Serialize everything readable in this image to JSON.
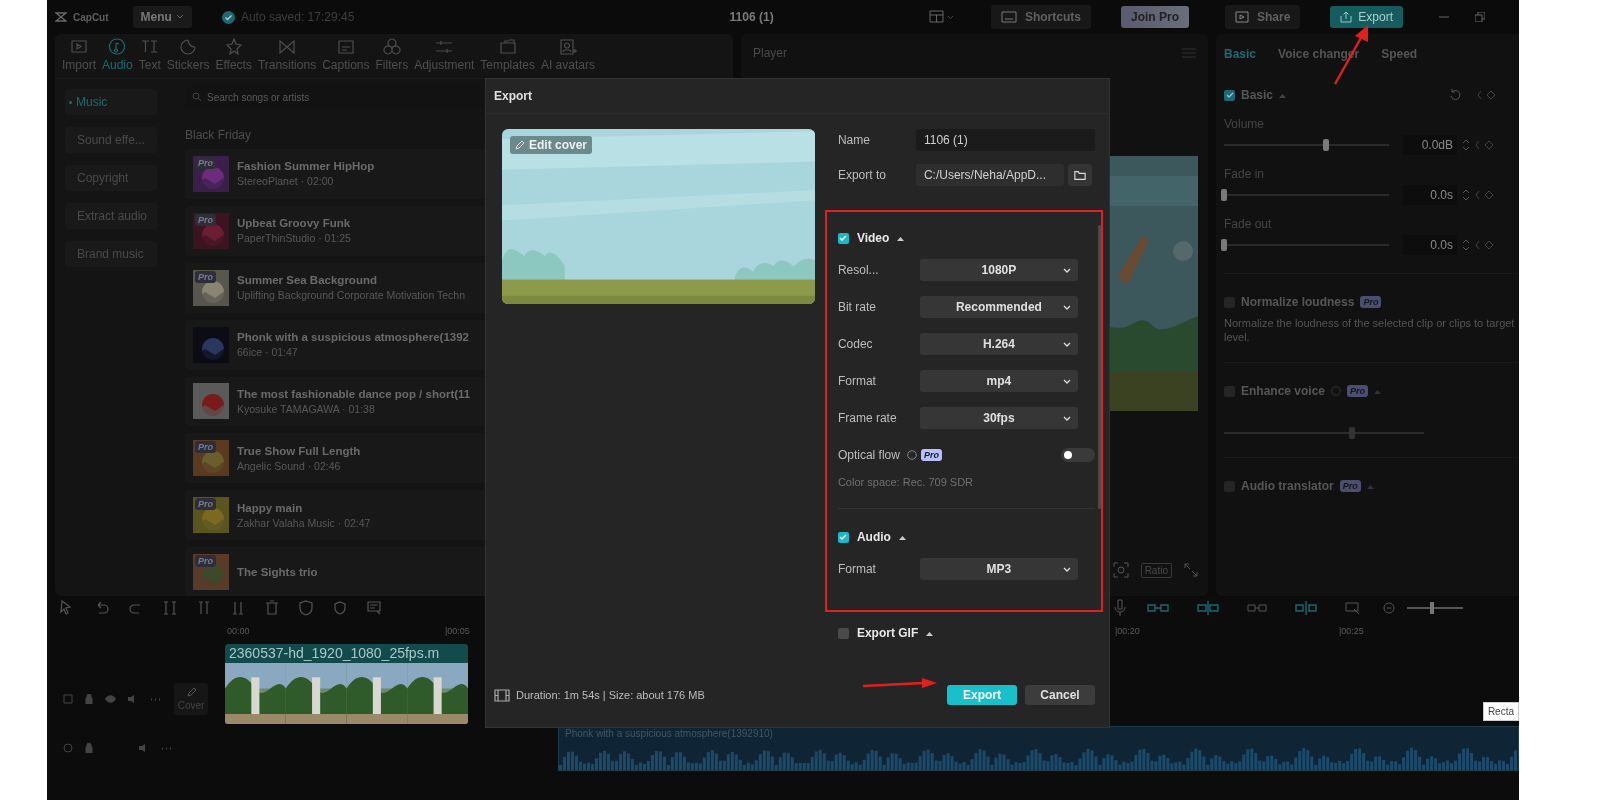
{
  "app": {
    "logo": "CapCut",
    "menu": "Menu",
    "autosave": "Auto saved: 17:29:45",
    "project_title": "1106 (1)",
    "shortcuts": "Shortcuts",
    "join_pro": "Join Pro",
    "share": "Share",
    "export": "Export"
  },
  "tool_tabs": [
    {
      "label": "Import",
      "kind": "import",
      "selected": false
    },
    {
      "label": "Audio",
      "kind": "audio",
      "selected": true
    },
    {
      "label": "Text",
      "kind": "text",
      "selected": false
    },
    {
      "label": "Stickers",
      "kind": "stickers",
      "selected": false
    },
    {
      "label": "Effects",
      "kind": "effects",
      "selected": false
    },
    {
      "label": "Transitions",
      "kind": "transitions",
      "selected": false
    },
    {
      "label": "Captions",
      "kind": "captions",
      "selected": false
    },
    {
      "label": "Filters",
      "kind": "filters",
      "selected": false
    },
    {
      "label": "Adjustment",
      "kind": "adjustment",
      "selected": false
    },
    {
      "label": "Templates",
      "kind": "templates",
      "selected": false
    },
    {
      "label": "AI avatars",
      "kind": "avatars",
      "selected": false
    }
  ],
  "categories": [
    {
      "label": "Music",
      "selected": true
    },
    {
      "label": "Sound effe...",
      "selected": false
    },
    {
      "label": "Copyright",
      "selected": false
    },
    {
      "label": "Extract audio",
      "selected": false
    },
    {
      "label": "Brand music",
      "selected": false
    }
  ],
  "search": {
    "placeholder": "Search songs or artists"
  },
  "section_title": "Black Friday",
  "songs": [
    {
      "title": "Fashion Summer HipHop",
      "subtitle": "StereoPlanet · 02:00",
      "badge": "Pro"
    },
    {
      "title": "Upbeat Groovy Funk",
      "subtitle": "PaperThinStudio · 01:25",
      "badge": "Pro"
    },
    {
      "title": "Summer Sea Background",
      "subtitle": "Uplifting Background Corporate Motivation Techn",
      "badge": "Pro"
    },
    {
      "title": "Phonk with a suspicious atmosphere(1392",
      "subtitle": "66ice · 01:47"
    },
    {
      "title": "The most fashionable dance pop / short(11",
      "subtitle": "Kyosuke TAMAGAWA · 01:38"
    },
    {
      "title": "True Show Full Length",
      "subtitle": "Angelic Sound · 02:46",
      "badge": "Pro"
    },
    {
      "title": "Happy main",
      "subtitle": "Zakhar Valaha Music · 02:47",
      "badge": "Pro"
    },
    {
      "title": "The Sights trio",
      "badge": "Pro"
    }
  ],
  "player": {
    "title": "Player",
    "ratio": "Ratio"
  },
  "inspector": {
    "tabs": [
      {
        "label": "Basic",
        "selected": true
      },
      {
        "label": "Voice changer",
        "selected": false
      },
      {
        "label": "Speed",
        "selected": false
      }
    ],
    "basic": {
      "label": "Basic",
      "checked": true
    },
    "sliders": [
      {
        "label": "Volume",
        "level": 0.62,
        "value": "0.0dB"
      },
      {
        "label": "Fade in",
        "level": 0,
        "value": "0.0s"
      },
      {
        "label": "Fade out",
        "level": 0,
        "value": "0.0s"
      }
    ],
    "normalize": {
      "label": "Normalize loudness",
      "badge": "Pro",
      "checked": false,
      "description": "Normalize the loudness of the selected clip or clips to target level."
    },
    "enhance": {
      "label": "Enhance voice",
      "badge": "Pro",
      "checked": false,
      "level": 0.64
    },
    "translator": {
      "label": "Audio translator",
      "badge": "Pro",
      "checked": false
    }
  },
  "timeline": {
    "zoom": {
      "level": 0.45
    },
    "ruler": [
      "00:00",
      "|00:05",
      "|00:20",
      "|00:25"
    ],
    "video_clip": "2360537-hd_1920_1080_25fps.m",
    "cover": "Cover",
    "audio_clip": "Phonk with a suspicious atmosphere(1392910)",
    "tooltip": "Recta"
  },
  "dialog": {
    "title": "Export",
    "edit_cover": "Edit cover",
    "name_label": "Name",
    "name": "1106 (1)",
    "export_to_label": "Export to",
    "export_to": "C:/Users/Neha/AppD...",
    "video": {
      "label": "Video",
      "checked": true
    },
    "video_settings": [
      {
        "label": "Resol...",
        "value": "1080P"
      },
      {
        "label": "Bit rate",
        "value": "Recommended"
      },
      {
        "label": "Codec",
        "value": "H.264"
      },
      {
        "label": "Format",
        "value": "mp4"
      },
      {
        "label": "Frame rate",
        "value": "30fps"
      }
    ],
    "optical_flow": {
      "label": "Optical flow",
      "badge": "Pro",
      "on": false
    },
    "color_space": "Color space: Rec. 709 SDR",
    "audio": {
      "label": "Audio",
      "checked": true
    },
    "audio_settings": [
      {
        "label": "Format",
        "value": "MP3"
      }
    ],
    "gif": {
      "label": "Export GIF",
      "checked": false
    },
    "summary": "Duration: 1m 54s | Size: about 176 MB",
    "export": "Export",
    "cancel": "Cancel"
  }
}
